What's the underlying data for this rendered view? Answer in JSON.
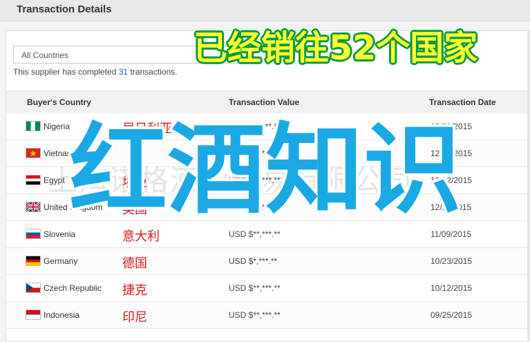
{
  "header": {
    "title": "Transaction Details"
  },
  "filter": {
    "selected": "All Countries"
  },
  "summary": {
    "prefix": "This supplier has completed ",
    "count": "31",
    "suffix": " transactions."
  },
  "columns": {
    "country": "Buyer's Country",
    "value": "Transaction Value",
    "date": "Transaction Date"
  },
  "rows": [
    {
      "country": "Nigeria",
      "cn": "尼日利亚",
      "value": "USD $**,***.**",
      "date": "12/01/2015",
      "flag": "nigeria-flag"
    },
    {
      "country": "Vietnam",
      "cn": "",
      "value": "USD $**,***.**",
      "date": "12/16/2015",
      "flag": "vietnam-flag"
    },
    {
      "country": "Egypt",
      "cn": "埃及",
      "value": "USD $**,***.**",
      "date": "12/12/2015",
      "flag": "egypt-flag"
    },
    {
      "country": "United Kingdom",
      "cn": "英国",
      "value": "USD $**,***.**",
      "date": "12/11/2015",
      "flag": "uk-flag"
    },
    {
      "country": "Slovenia",
      "cn": "意大利",
      "value": "USD $**,***.**",
      "date": "11/09/2015",
      "flag": "slovenia-flag"
    },
    {
      "country": "Germany",
      "cn": "德国",
      "value": "USD $*,***.**",
      "date": "10/23/2015",
      "flag": "germany-flag"
    },
    {
      "country": "Czech Republic",
      "cn": "捷克",
      "value": "USD $**,***.**",
      "date": "10/12/2015",
      "flag": "czech-flag"
    },
    {
      "country": "Indonesia",
      "cn": "印尼",
      "value": "USD $**,***.**",
      "date": "09/25/2015",
      "flag": "indonesia-flag"
    }
  ],
  "overlay": {
    "top_text": "已经销往52个国家",
    "big_text": "红酒知识",
    "watermark": "上海诺格酒业贸易有限公司"
  },
  "colors": {
    "accent_link": "#1a5fb4",
    "overlay_yellow": "#ffff33",
    "overlay_blue": "#1ba9e6",
    "cn_red": "#d61a1a"
  }
}
